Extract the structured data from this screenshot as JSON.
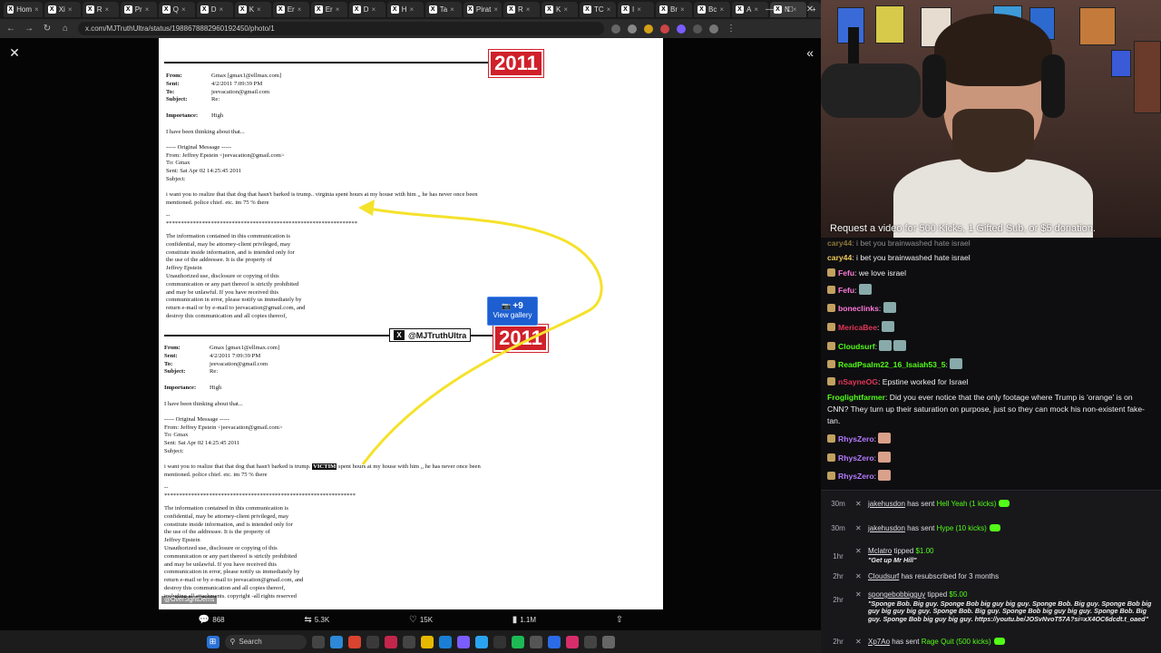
{
  "browser": {
    "tabs": [
      {
        "label": "Hom",
        "active": false
      },
      {
        "label": "Xi",
        "active": false
      },
      {
        "label": "R",
        "active": false
      },
      {
        "label": "Pr",
        "active": false
      },
      {
        "label": "Q",
        "active": false
      },
      {
        "label": "D",
        "active": false
      },
      {
        "label": "K",
        "active": false
      },
      {
        "label": "Er",
        "active": false
      },
      {
        "label": "Er",
        "active": false
      },
      {
        "label": "D",
        "active": false
      },
      {
        "label": "H",
        "active": false
      },
      {
        "label": "Ta",
        "active": false
      },
      {
        "label": "Pirat",
        "active": false
      },
      {
        "label": "R",
        "active": false
      },
      {
        "label": "K",
        "active": false
      },
      {
        "label": "TC",
        "active": false
      },
      {
        "label": "I",
        "active": false
      },
      {
        "label": "Br",
        "active": false
      },
      {
        "label": "Bc",
        "active": false
      },
      {
        "label": "A",
        "active": false
      },
      {
        "label": "N",
        "active": true
      }
    ],
    "url": "x.com/MJTruthUltra/status/1988678882960192450/photo/1"
  },
  "document": {
    "year_badge": "2011",
    "email_top": {
      "from_label": "From:",
      "from": "Gmax [gmax1@ellmax.com]",
      "sent_label": "Sent:",
      "sent": "4/2/2011 7:09:39 PM",
      "to_label": "To:",
      "to": "jeevacation@gmail.com",
      "subject_label": "Subject:",
      "subject": "Re:",
      "importance_label": "Importance:",
      "importance": "High",
      "body1": "I have been thinking about that...",
      "orig": "----- Original Message -----",
      "orig_from": "From: Jeffrey Epstein <jeevacation@gmail.com>",
      "orig_to": "To: Gmax",
      "orig_sent": "Sent: Sat Apr 02 14:25:45 2011",
      "orig_subject": "Subject:",
      "line_a": "i want you to realize that that dog that hasn't barked is trump.. virginia  spent hours at my house with him ,, he has never once been",
      "line_b": "mentioned.   police chief. etc.   im 75 % there",
      "dashes": "--",
      "stars": "****************************************************************",
      "disclaimer1": "The information contained in this communication is",
      "disclaimer2": "confidential, may be attorney-client privileged, may",
      "disclaimer3": "constitute inside information, and is intended only for",
      "disclaimer4": "the use of the addressee. It is the property of",
      "disclaimer5": "Jeffrey Epstein",
      "disclaimer6": "Unauthorized use, disclosure or copying of this",
      "disclaimer7": "communication or any part thereof is strictly prohibited",
      "disclaimer8": "and may be unlawful. If you have received this",
      "disclaimer9": "communication in error, please notify us immediately by",
      "disclaimer10": "return e-mail or by e-mail to jeevacation@gmail.com, and",
      "disclaimer11": "destroy this communication and all copies thereof,"
    },
    "email_bottom": {
      "line_a_pre": "i want you to realize that that dog that hasn't barked is trump.",
      "victim": "VICTIM",
      "line_a_post": "spent hours at my house with him ,, he has never once been",
      "disclaimer12": "including all attachments. copyright -all rights reserved"
    },
    "handle": "@MJTruthUltra",
    "gallery_count": "+9",
    "gallery_label": "View gallery",
    "watermark": "@OversightDems"
  },
  "actions": {
    "replies": "868",
    "reposts": "5.3K",
    "likes": "15K",
    "views": "1.1M"
  },
  "taskbar": {
    "search_label": "Search"
  },
  "stream": {
    "caption": "Request a video for 500 Kicks, 1 Gifted Sub, or $5 donation."
  },
  "chat": [
    {
      "user": "cary44",
      "text": "i bet you brainwashed hate israel",
      "color": "#f0c85a",
      "partial": true
    },
    {
      "user": "cary44",
      "text": "i bet you brainwashed hate israel",
      "color": "#f0c85a"
    },
    {
      "user": "Fefu",
      "text": "we love israel",
      "color": "#ff7ad9"
    },
    {
      "user": "Fefu",
      "text": "",
      "color": "#ff7ad9"
    },
    {
      "user": "boneclinks",
      "text": "",
      "color": "#ff7ad9"
    },
    {
      "user": "MericaBee",
      "text": "",
      "color": "#e2365a"
    },
    {
      "user": "Cloudsurf",
      "text": "",
      "color": "#53fc18"
    },
    {
      "user": "ReadPsalm22_16_Isaiah53_5",
      "text": "",
      "color": "#53fc18"
    },
    {
      "user": "nSayneOG",
      "text": "Epstine worked for Israel",
      "color": "#e2365a"
    },
    {
      "user": "Froglightfarmer",
      "text": "Did you ever notice that the only footage where Trump is 'orange' is on CNN? They turn up their saturation on purpose, just so they can mock his non-existent fake-tan.",
      "color": "#53fc18"
    },
    {
      "user": "RhysZero",
      "text": "",
      "color": "#b57aff"
    },
    {
      "user": "RhysZero",
      "text": "",
      "color": "#b57aff"
    },
    {
      "user": "RhysZero",
      "text": "",
      "color": "#b57aff"
    }
  ],
  "events": [
    {
      "time": "30m",
      "user": "jakehusdon",
      "pre": "has sent",
      "item": "Hell Yeah (1 kicks)",
      "note": ""
    },
    {
      "time": "30m",
      "user": "jakehusdon",
      "pre": "has sent",
      "item": "Hype (10 kicks)",
      "note": ""
    },
    {
      "time": "1hr",
      "user": "Mclatro",
      "pre": "tipped",
      "item": "$1.00",
      "note": "\"Get up Mr Hill\""
    },
    {
      "time": "2hr",
      "user": "Cloudsurf",
      "pre": "has resubscribed for 3 months",
      "item": "",
      "note": ""
    },
    {
      "time": "2hr",
      "user": "spongebobbigguy",
      "pre": "tipped",
      "item": "$5.00",
      "note": "\"Sponge Bob. Big guy. Sponge Bob big guy big guy. Sponge Bob. Big guy. Sponge Bob big guy big guy big guy. Sponge Bob. Big guy. Sponge Bob big guy big guy. Sponge Bob. Big guy. Sponge Bob big guy big guy. https://youtu.be/JOSvNvoT57A?si=xX4OC6dcdt.t_oaed\""
    },
    {
      "time": "2hr",
      "user": "Xp7Ao",
      "pre": "has sent",
      "item": "Rage Quit (500 kicks)",
      "note": ""
    }
  ]
}
